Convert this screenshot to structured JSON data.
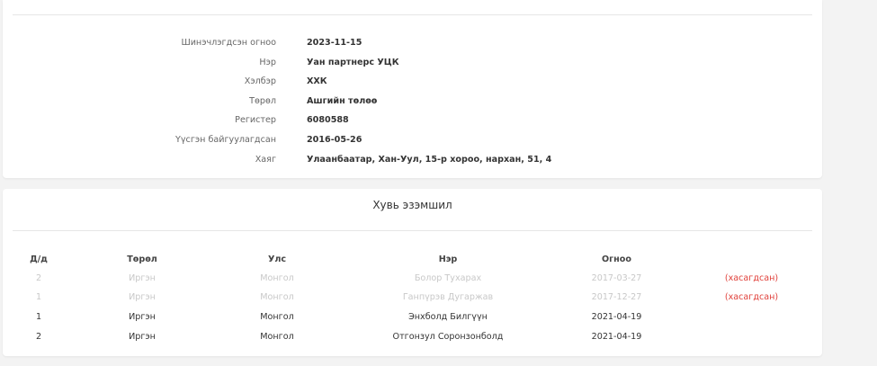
{
  "company_info": {
    "rows": [
      {
        "label": "Шинэчлэгдсэн огноо",
        "value": "2023-11-15"
      },
      {
        "label": "Нэр",
        "value": "Уан партнерс УЦК"
      },
      {
        "label": "Хэлбэр",
        "value": "ХХК"
      },
      {
        "label": "Төрөл",
        "value": "Ашгийн төлөө"
      },
      {
        "label": "Регистер",
        "value": "6080588"
      },
      {
        "label": "Үүсгэн байгуулагдсан",
        "value": "2016-05-26"
      },
      {
        "label": "Хаяг",
        "value": "Улаанбаатар, Хан-Уул, 15-р хороо, нархан, 51, 4"
      }
    ]
  },
  "ownership": {
    "title": "Хувь эзэмшил",
    "headers": [
      "Д/д",
      "Төрөл",
      "Улс",
      "Нэр",
      "Огноо",
      ""
    ],
    "rows": [
      {
        "no": "2",
        "type": "Иргэн",
        "country": "Монгол",
        "name": "Болор Тухарах",
        "date": "2017-03-27",
        "status": "(хасагдсан)",
        "deleted": true
      },
      {
        "no": "1",
        "type": "Иргэн",
        "country": "Монгол",
        "name": "Ганпүрэв Дугаржав",
        "date": "2017-12-27",
        "status": "(хасагдсан)",
        "deleted": true
      },
      {
        "no": "1",
        "type": "Иргэн",
        "country": "Монгол",
        "name": "Энхболд Билгүүн",
        "date": "2021-04-19",
        "status": "",
        "deleted": false
      },
      {
        "no": "2",
        "type": "Иргэн",
        "country": "Монгол",
        "name": "Отгонзул Соронзонболд",
        "date": "2021-04-19",
        "status": "",
        "deleted": false
      }
    ]
  },
  "colors": {
    "background": "#f3f3f3",
    "card": "#ffffff",
    "deleted_text": "#c8c8c8",
    "deleted_tag": "#e0403a"
  }
}
